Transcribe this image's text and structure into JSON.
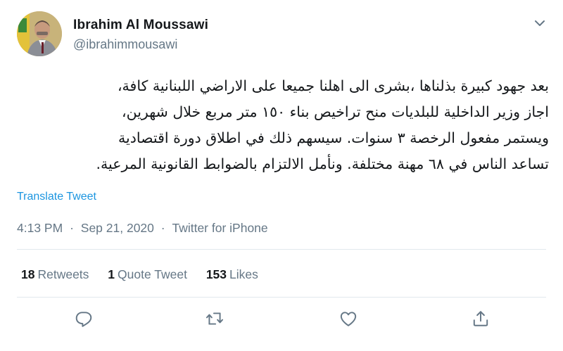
{
  "user": {
    "display_name": "Ibrahim Al Moussawi",
    "handle": "@ibrahimmousawi",
    "avatar_icon": "profile-photo"
  },
  "tweet": {
    "text": "بعد جهود كبيرة بذلناها ،بشرى الى اهلنا جميعا على الاراضي اللبنانية كافة،\nاجاز وزير الداخلية للبلديات منح تراخيص بناء ١٥٠ متر مربع خلال شهرين،\nويستمر مفعول الرخصة ٣ سنوات. سيسهم ذلك في اطلاق دورة اقتصادية\nتساعد الناس في ٦٨ مهنة مختلفة. ونأمل الالتزام بالضوابط القانونية المرعية.",
    "translate_label": "Translate Tweet"
  },
  "meta": {
    "time": "4:13 PM",
    "separator": "·",
    "date": "Sep 21, 2020",
    "source": "Twitter for iPhone"
  },
  "stats": {
    "retweets_count": "18",
    "retweets_label": "Retweets",
    "quotes_count": "1",
    "quotes_label": "Quote Tweet",
    "likes_count": "153",
    "likes_label": "Likes"
  },
  "colors": {
    "text": "#14171a",
    "secondary": "#657786",
    "link": "#1b95e0",
    "divider": "#e1e8ed"
  },
  "icons": {
    "more": "chevron-down-icon",
    "reply": "reply-icon",
    "retweet": "retweet-icon",
    "like": "like-icon",
    "share": "share-icon"
  }
}
